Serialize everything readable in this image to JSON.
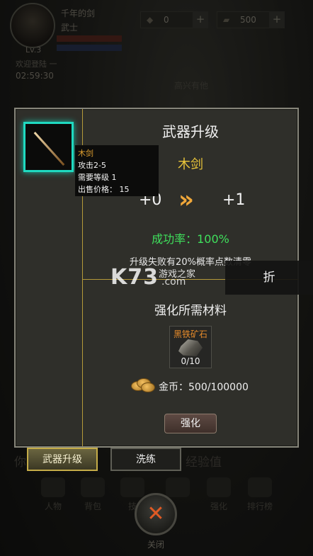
{
  "hud": {
    "player_name": "千年的剑",
    "player_title": "武士",
    "level": "Lv.3",
    "status_line": "欢迎登陆 一",
    "timer": "02:59:30",
    "gold": "0",
    "ingot": "500"
  },
  "background": {
    "mark": "高兴有他",
    "text_left": "你",
    "text_right": "经验值"
  },
  "dialog": {
    "title": "武器升级",
    "weapon_name": "木剑",
    "level_from": "+0",
    "level_to": "+1",
    "arrows": "»",
    "success_rate": "成功率：100%",
    "fail_note": "升级失败有20%概率点数清零",
    "materials_title": "强化所需材料",
    "material": {
      "name": "黑铁矿石",
      "count": "0/10"
    },
    "gold_cost": "金币：500/100000",
    "upgrade_button": "强化"
  },
  "tooltip": {
    "name": "木剑",
    "attack": "攻击2-5",
    "required_level": "需要等级 1",
    "sell_price": "出售价格：  15"
  },
  "tabs": [
    {
      "label": "武器升级",
      "active": true
    },
    {
      "label": "洗练",
      "active": false
    }
  ],
  "nav": {
    "items": [
      "人物",
      "背包",
      "技",
      "",
      "强化",
      "排行榜"
    ],
    "close_label": "关闭",
    "close_glyph": "✕"
  },
  "watermark": {
    "logo": "K73",
    "domain": ".com",
    "sub": "游戏之家"
  },
  "side_tag": "折",
  "colors": {
    "accent_gold": "#e8c43a",
    "success_green": "#3fe05c",
    "slot_glow": "#1fd9c0",
    "material_orange": "#e58a2a",
    "close_orange": "#e05a24"
  }
}
